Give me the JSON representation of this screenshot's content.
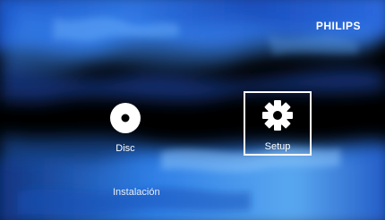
{
  "brand": {
    "logo_text": "PHILIPS"
  },
  "menu": {
    "items": [
      {
        "label": "Disc",
        "icon": "disc-icon",
        "selected": false
      },
      {
        "label": "Setup",
        "icon": "gear-icon",
        "selected": true
      }
    ]
  },
  "footer": {
    "caption": "Instalación"
  },
  "colors": {
    "background": "#000000",
    "accent_blue": "#2a6fd6",
    "text": "#ffffff"
  }
}
